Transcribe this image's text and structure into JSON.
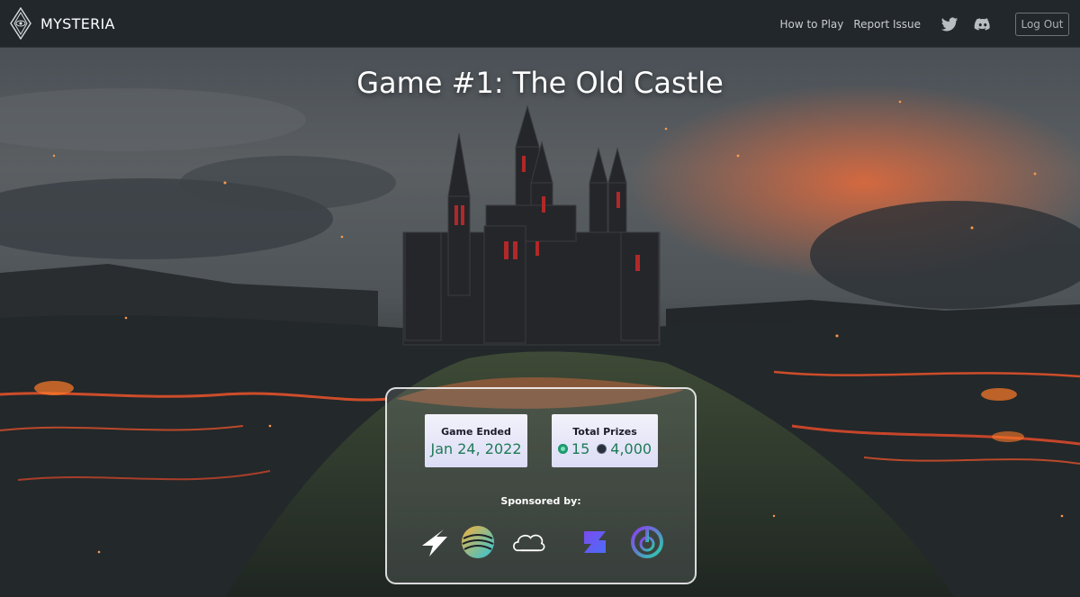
{
  "nav": {
    "brand": "MYSTERIA",
    "links": [
      "How to Play",
      "Report Issue"
    ],
    "logout": "Log Out"
  },
  "hero": {
    "title": "Game #1: The Old Castle"
  },
  "stats": {
    "ended_label": "Game Ended",
    "ended_value": "Jan 24, 2022",
    "prizes_label": "Total Prizes",
    "prize_a": "15",
    "prize_b": "4,000"
  },
  "sponsored_label": "Sponsored by:",
  "icons": [
    "mysteria-logo-icon",
    "twitter-icon",
    "discord-icon",
    "lightning-sponsor-icon",
    "sphere-sponsor-icon",
    "chef-hat-sponsor-icon",
    "s-sponsor-icon",
    "power-sponsor-icon"
  ],
  "colors": {
    "navbar": "#22272c",
    "stat_value": "#1e7a57",
    "accent_lava": "#e0512a"
  }
}
